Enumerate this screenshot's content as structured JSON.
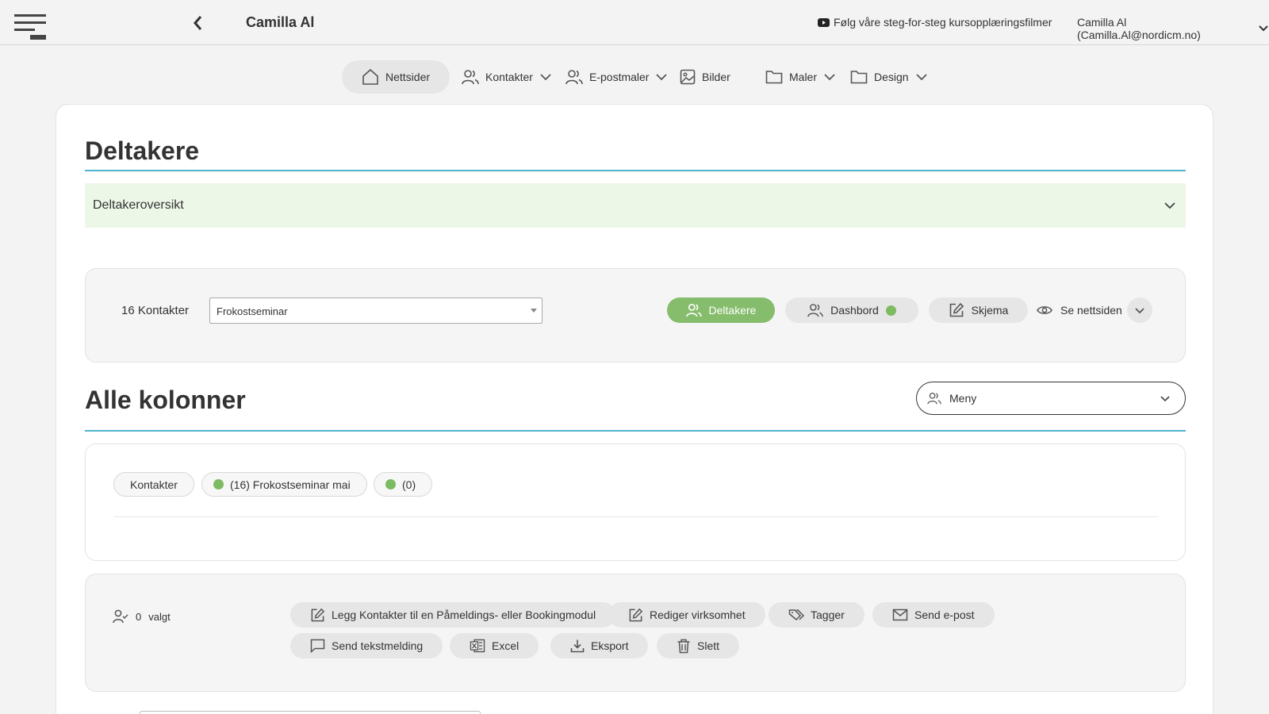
{
  "header": {
    "app_title": "Camilla Al",
    "tutorial_link": "Følg våre steg-for-steg kursopplæringsfilmer",
    "user_menu": "Camilla Al (Camilla.Al@nordicm.no)"
  },
  "nav": {
    "items": [
      {
        "label": "Nettsider",
        "icon": "home-icon",
        "active": true
      },
      {
        "label": "Kontakter",
        "icon": "users-icon",
        "has_dropdown": true
      },
      {
        "label": "E-postmaler",
        "icon": "users-icon",
        "has_dropdown": true
      },
      {
        "label": "Bilder",
        "icon": "image-icon"
      },
      {
        "label": "Maler",
        "icon": "folder-icon",
        "has_dropdown": true
      },
      {
        "label": "Design",
        "icon": "folder-icon",
        "has_dropdown": true
      }
    ]
  },
  "page": {
    "title": "Deltakere",
    "accordion_label": "Deltakeroversikt"
  },
  "toolbar": {
    "count_label": "16 Kontakter",
    "event_select": "Frokostseminar",
    "buttons": {
      "participants": "Deltakere",
      "dashboard": "Dashbord",
      "form": "Skjema",
      "view_site": "Se nettsiden"
    }
  },
  "columns": {
    "title": "Alle kolonner",
    "menu_label": "Meny",
    "chips": [
      "Kontakter",
      "(16) Frokostseminar mai",
      "(0)"
    ]
  },
  "actions": {
    "selected_count": "0",
    "selected_label": "valgt",
    "add_to_module": "Legg Kontakter til en Påmeldings- eller Bookingmodul",
    "edit_company": "Rediger virksomhet",
    "tags": "Tagger",
    "send_email": "Send e-post",
    "send_sms": "Send tekstmelding",
    "excel": "Excel",
    "export": "Eksport",
    "delete": "Slett"
  },
  "colors": {
    "accent_line": "#4eb3cc",
    "green_button": "#86bd6c",
    "status_dot": "#7dbb62",
    "accordion_bg": "#edf7e8"
  }
}
